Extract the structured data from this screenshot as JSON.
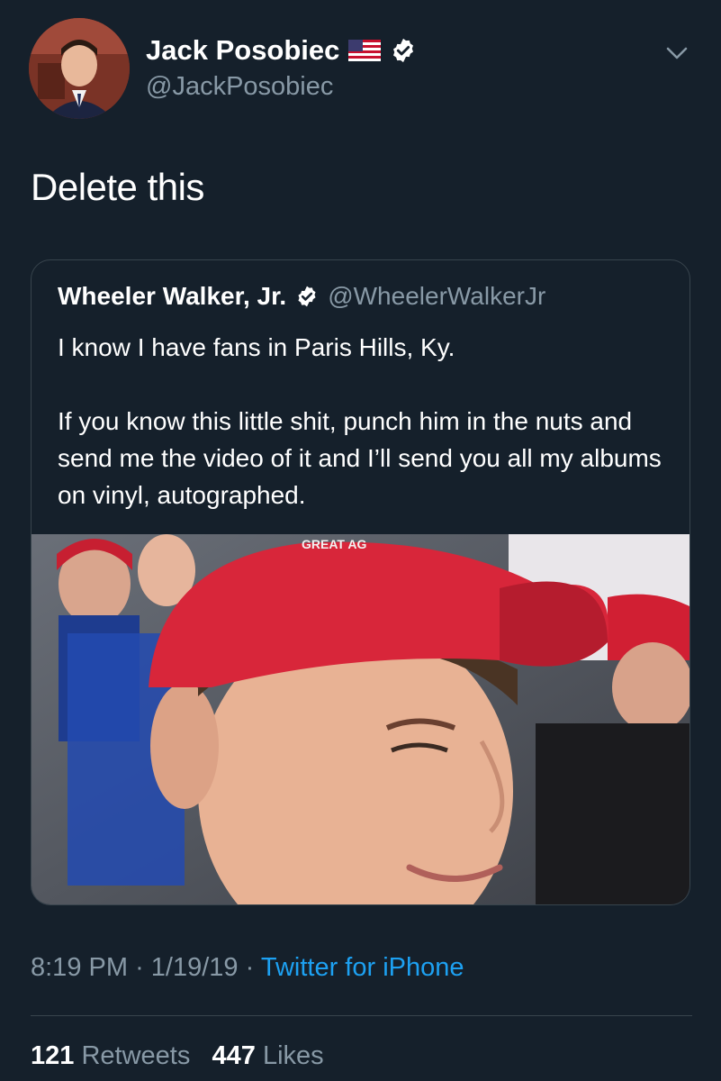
{
  "author": {
    "display_name": "Jack Posobiec",
    "handle": "@JackPosobiec",
    "flag_icon": "us-flag-icon",
    "verified": true
  },
  "tweet": {
    "text": "Delete this"
  },
  "quoted_tweet": {
    "display_name": "Wheeler Walker, Jr.",
    "handle": "@WheelerWalkerJr",
    "verified": true,
    "text": "I know I have fans in Paris Hills, Ky.\n\nIf you know this little shit, punch him in the nuts and send me the video of it and I’ll send you all my albums on vinyl, autographed.",
    "media_caption": "GREAT AG"
  },
  "meta": {
    "time": "8:19 PM",
    "separator": "·",
    "date": "1/19/19",
    "source": "Twitter for iPhone"
  },
  "stats": {
    "retweets_count": "121",
    "retweets_label": "Retweets",
    "likes_count": "447",
    "likes_label": "Likes"
  },
  "colors": {
    "background": "#15202b",
    "secondary_text": "#8899a6",
    "link": "#1da1f2",
    "cap_red": "#d8263a"
  }
}
